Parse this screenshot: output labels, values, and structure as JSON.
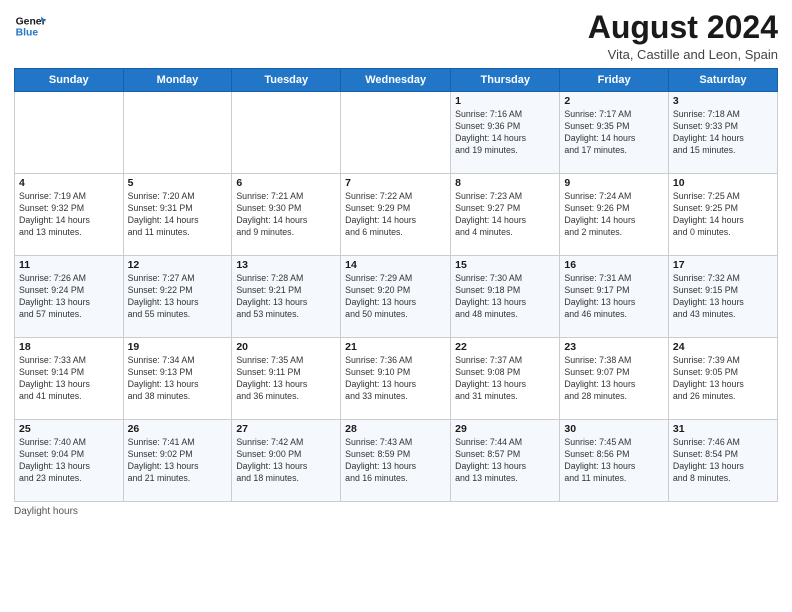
{
  "header": {
    "logo_general": "General",
    "logo_blue": "Blue",
    "month_year": "August 2024",
    "location": "Vita, Castille and Leon, Spain"
  },
  "days_of_week": [
    "Sunday",
    "Monday",
    "Tuesday",
    "Wednesday",
    "Thursday",
    "Friday",
    "Saturday"
  ],
  "weeks": [
    [
      {
        "day": "",
        "info": ""
      },
      {
        "day": "",
        "info": ""
      },
      {
        "day": "",
        "info": ""
      },
      {
        "day": "",
        "info": ""
      },
      {
        "day": "1",
        "info": "Sunrise: 7:16 AM\nSunset: 9:36 PM\nDaylight: 14 hours\nand 19 minutes."
      },
      {
        "day": "2",
        "info": "Sunrise: 7:17 AM\nSunset: 9:35 PM\nDaylight: 14 hours\nand 17 minutes."
      },
      {
        "day": "3",
        "info": "Sunrise: 7:18 AM\nSunset: 9:33 PM\nDaylight: 14 hours\nand 15 minutes."
      }
    ],
    [
      {
        "day": "4",
        "info": "Sunrise: 7:19 AM\nSunset: 9:32 PM\nDaylight: 14 hours\nand 13 minutes."
      },
      {
        "day": "5",
        "info": "Sunrise: 7:20 AM\nSunset: 9:31 PM\nDaylight: 14 hours\nand 11 minutes."
      },
      {
        "day": "6",
        "info": "Sunrise: 7:21 AM\nSunset: 9:30 PM\nDaylight: 14 hours\nand 9 minutes."
      },
      {
        "day": "7",
        "info": "Sunrise: 7:22 AM\nSunset: 9:29 PM\nDaylight: 14 hours\nand 6 minutes."
      },
      {
        "day": "8",
        "info": "Sunrise: 7:23 AM\nSunset: 9:27 PM\nDaylight: 14 hours\nand 4 minutes."
      },
      {
        "day": "9",
        "info": "Sunrise: 7:24 AM\nSunset: 9:26 PM\nDaylight: 14 hours\nand 2 minutes."
      },
      {
        "day": "10",
        "info": "Sunrise: 7:25 AM\nSunset: 9:25 PM\nDaylight: 14 hours\nand 0 minutes."
      }
    ],
    [
      {
        "day": "11",
        "info": "Sunrise: 7:26 AM\nSunset: 9:24 PM\nDaylight: 13 hours\nand 57 minutes."
      },
      {
        "day": "12",
        "info": "Sunrise: 7:27 AM\nSunset: 9:22 PM\nDaylight: 13 hours\nand 55 minutes."
      },
      {
        "day": "13",
        "info": "Sunrise: 7:28 AM\nSunset: 9:21 PM\nDaylight: 13 hours\nand 53 minutes."
      },
      {
        "day": "14",
        "info": "Sunrise: 7:29 AM\nSunset: 9:20 PM\nDaylight: 13 hours\nand 50 minutes."
      },
      {
        "day": "15",
        "info": "Sunrise: 7:30 AM\nSunset: 9:18 PM\nDaylight: 13 hours\nand 48 minutes."
      },
      {
        "day": "16",
        "info": "Sunrise: 7:31 AM\nSunset: 9:17 PM\nDaylight: 13 hours\nand 46 minutes."
      },
      {
        "day": "17",
        "info": "Sunrise: 7:32 AM\nSunset: 9:15 PM\nDaylight: 13 hours\nand 43 minutes."
      }
    ],
    [
      {
        "day": "18",
        "info": "Sunrise: 7:33 AM\nSunset: 9:14 PM\nDaylight: 13 hours\nand 41 minutes."
      },
      {
        "day": "19",
        "info": "Sunrise: 7:34 AM\nSunset: 9:13 PM\nDaylight: 13 hours\nand 38 minutes."
      },
      {
        "day": "20",
        "info": "Sunrise: 7:35 AM\nSunset: 9:11 PM\nDaylight: 13 hours\nand 36 minutes."
      },
      {
        "day": "21",
        "info": "Sunrise: 7:36 AM\nSunset: 9:10 PM\nDaylight: 13 hours\nand 33 minutes."
      },
      {
        "day": "22",
        "info": "Sunrise: 7:37 AM\nSunset: 9:08 PM\nDaylight: 13 hours\nand 31 minutes."
      },
      {
        "day": "23",
        "info": "Sunrise: 7:38 AM\nSunset: 9:07 PM\nDaylight: 13 hours\nand 28 minutes."
      },
      {
        "day": "24",
        "info": "Sunrise: 7:39 AM\nSunset: 9:05 PM\nDaylight: 13 hours\nand 26 minutes."
      }
    ],
    [
      {
        "day": "25",
        "info": "Sunrise: 7:40 AM\nSunset: 9:04 PM\nDaylight: 13 hours\nand 23 minutes."
      },
      {
        "day": "26",
        "info": "Sunrise: 7:41 AM\nSunset: 9:02 PM\nDaylight: 13 hours\nand 21 minutes."
      },
      {
        "day": "27",
        "info": "Sunrise: 7:42 AM\nSunset: 9:00 PM\nDaylight: 13 hours\nand 18 minutes."
      },
      {
        "day": "28",
        "info": "Sunrise: 7:43 AM\nSunset: 8:59 PM\nDaylight: 13 hours\nand 16 minutes."
      },
      {
        "day": "29",
        "info": "Sunrise: 7:44 AM\nSunset: 8:57 PM\nDaylight: 13 hours\nand 13 minutes."
      },
      {
        "day": "30",
        "info": "Sunrise: 7:45 AM\nSunset: 8:56 PM\nDaylight: 13 hours\nand 11 minutes."
      },
      {
        "day": "31",
        "info": "Sunrise: 7:46 AM\nSunset: 8:54 PM\nDaylight: 13 hours\nand 8 minutes."
      }
    ]
  ],
  "footer": {
    "note": "Daylight hours"
  }
}
